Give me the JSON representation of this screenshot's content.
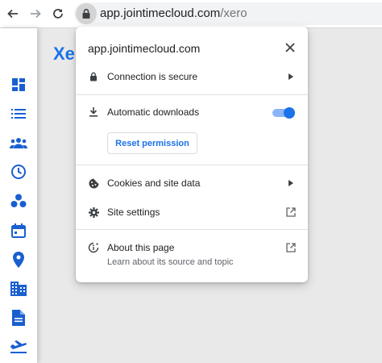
{
  "browser": {
    "url_domain": "app.jointimecloud.com",
    "url_path": "/xero"
  },
  "page": {
    "title_partial": "Xe"
  },
  "sidebar": {
    "icons": [
      "dashboard-icon",
      "list-icon",
      "people-icon",
      "clock-icon",
      "bubbles-icon",
      "calendar-icon",
      "location-icon",
      "building-icon",
      "document-icon",
      "flight-icon"
    ]
  },
  "popup": {
    "title": "app.jointimecloud.com",
    "connection": "Connection is secure",
    "automatic_downloads": "Automatic downloads",
    "automatic_downloads_enabled": true,
    "reset_permission": "Reset permission",
    "cookies": "Cookies and site data",
    "site_settings": "Site settings",
    "about": "About this page",
    "about_sub": "Learn about its source and topic"
  },
  "colors": {
    "accent": "#1a73e8",
    "sidebar_icon": "#1a5fd0"
  }
}
